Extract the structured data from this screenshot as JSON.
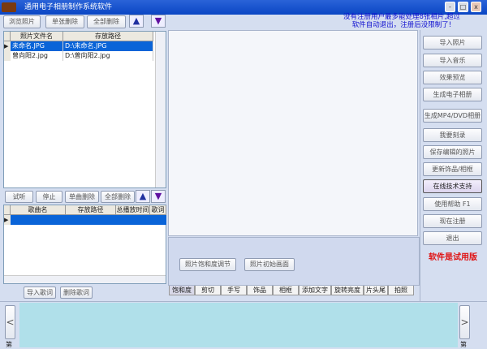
{
  "window": {
    "title": "通用电子相册制作系统软件",
    "min": "-",
    "max": "□",
    "close": "x"
  },
  "notice": {
    "line1": "没有注册用户最多能处理8张相片,超过",
    "line2": "软件自动退出，注册后没限制了!"
  },
  "photo_toolbar": {
    "browse": "浏览照片",
    "delete_one": "单张删除",
    "delete_all": "全部删除",
    "up": "▲",
    "down": "▼"
  },
  "photo_table": {
    "columns": [
      "照片文件名",
      "存放路径"
    ],
    "rows": [
      [
        "未命名.JPG",
        "D:\\未命名.JPG"
      ],
      [
        "曾向阳2.jpg",
        "D:\\曾向阳2.jpg"
      ]
    ]
  },
  "music_toolbar": {
    "listen": "试听",
    "stop": "停止",
    "delete_one": "单曲删除",
    "delete_all": "全部删除",
    "up": "▲",
    "down": "▼"
  },
  "music_table": {
    "columns": [
      "歌曲名",
      "存放路径",
      "总播放时间",
      "歌词"
    ]
  },
  "lyrics": {
    "import": "导入歌词",
    "delete": "删除歌词"
  },
  "right_buttons": [
    "导入照片",
    "导入音乐",
    "效果预览",
    "生成电子相册",
    "生成MP4/DVD相册",
    "我要刻录",
    "保存编辑的照片",
    "更新饰品/相框",
    "在线技术支持",
    "使用帮助  F1",
    "现在注册",
    "退出"
  ],
  "trial_text": "软件是试用版",
  "edit_panel": {
    "saturation_btn": "照片饱和度调节",
    "reset_btn": "照片初始画面"
  },
  "tabs": [
    "饱和度",
    "剪切",
    "手写",
    "饰品",
    "相框",
    "添加文字",
    "旋转亮度",
    "片头尾",
    "拍照"
  ],
  "bottom": {
    "left_arrow": "<",
    "right_arrow": ">",
    "left_label": "第",
    "right_label": "第"
  }
}
